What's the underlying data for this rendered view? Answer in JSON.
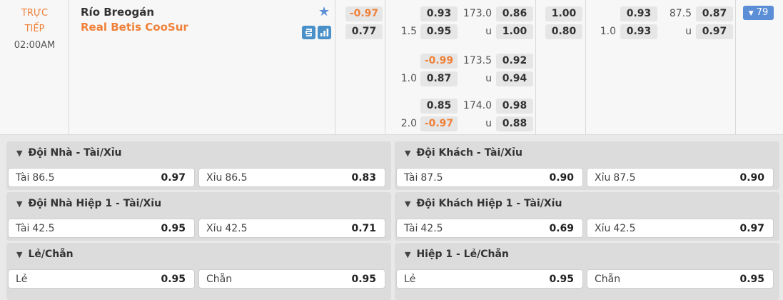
{
  "match": {
    "status_line1": "TRỰC",
    "status_line2": "TIẾP",
    "time": "02:00AM",
    "home_team": "Río Breogán",
    "away_team": "Real Betis CooSur",
    "more_count": "79",
    "colors": {
      "accent": "#f0813a",
      "blue": "#5b8ed6"
    },
    "icons": [
      "star-icon",
      "scoreboard-icon",
      "stats-icon",
      "chevron-down-icon"
    ]
  },
  "main_odds": {
    "moneyline": {
      "home": "-0.97",
      "away": "0.77"
    },
    "handicap_rows": [
      {
        "line": "",
        "home": "0.93",
        "away_line": "1.5",
        "away": "0.95"
      },
      {
        "line": "",
        "home": "-0.99",
        "away_line": "1.0",
        "away": "0.87"
      },
      {
        "line": "",
        "home": "0.85",
        "away_line": "2.0",
        "away": "-0.97"
      }
    ],
    "total_rows": [
      {
        "line": "173.0",
        "over": "0.86",
        "u": "u",
        "under": "1.00"
      },
      {
        "line": "173.5",
        "over": "0.92",
        "u": "u",
        "under": "0.94"
      },
      {
        "line": "174.0",
        "over": "0.98",
        "u": "u",
        "under": "0.88"
      }
    ],
    "half_moneyline": {
      "home": "1.00",
      "away": "0.80"
    },
    "half_handicap": {
      "home": "0.93",
      "line": "1.0",
      "away": "0.93"
    },
    "half_total": {
      "line": "87.5",
      "over": "0.87",
      "u": "u",
      "under": "0.97"
    }
  },
  "panels": [
    {
      "title": "Đội Nhà - Tài/Xỉu",
      "a_name": "Tài",
      "a_line": "86.5",
      "a_price": "0.97",
      "b_name": "Xỉu",
      "b_line": "86.5",
      "b_price": "0.83"
    },
    {
      "title": "Đội Khách - Tài/Xỉu",
      "a_name": "Tài",
      "a_line": "87.5",
      "a_price": "0.90",
      "b_name": "Xỉu",
      "b_line": "87.5",
      "b_price": "0.90"
    },
    {
      "title": "Đội Nhà Hiệp 1 - Tài/Xỉu",
      "a_name": "Tài",
      "a_line": "42.5",
      "a_price": "0.95",
      "b_name": "Xỉu",
      "b_line": "42.5",
      "b_price": "0.71"
    },
    {
      "title": "Đội Khách Hiệp 1 - Tài/Xỉu",
      "a_name": "Tài",
      "a_line": "42.5",
      "a_price": "0.69",
      "b_name": "Xỉu",
      "b_line": "42.5",
      "b_price": "0.97"
    },
    {
      "title": "Lẻ/Chẵn",
      "a_name": "Lẻ",
      "a_line": "",
      "a_price": "0.95",
      "b_name": "Chẵn",
      "b_line": "",
      "b_price": "0.95"
    },
    {
      "title": "Hiệp 1 - Lẻ/Chẵn",
      "a_name": "Lẻ",
      "a_line": "",
      "a_price": "0.95",
      "b_name": "Chẵn",
      "b_line": "",
      "b_price": "0.95"
    }
  ]
}
